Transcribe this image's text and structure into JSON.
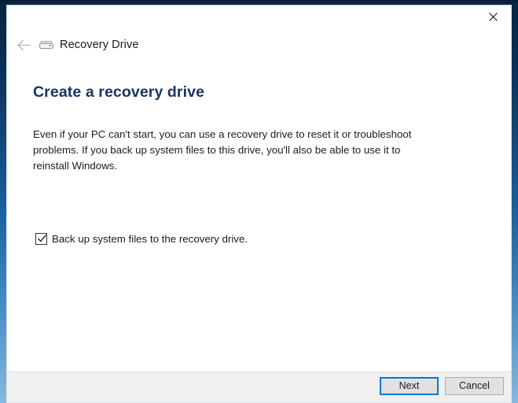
{
  "window": {
    "app_title": "Recovery Drive",
    "app_icon": "drive-icon",
    "back_icon": "back-arrow-icon",
    "close_icon": "close-icon",
    "close_label": "Close"
  },
  "page": {
    "heading": "Create a recovery drive",
    "description": "Even if your PC can't start, you can use a recovery drive to reset it or troubleshoot problems. If you back up system files to this drive, you'll also be able to use it to reinstall Windows.",
    "checkbox": {
      "label": "Back up system files to the recovery drive.",
      "checked": true,
      "icon": "check-icon"
    }
  },
  "footer": {
    "next_label": "Next",
    "cancel_label": "Cancel"
  },
  "colors": {
    "heading": "#18355f",
    "accent": "#0078d7",
    "button_face": "#e1e1e1",
    "button_border": "#adadad",
    "footer_bg": "#f0f0f0",
    "window_bg": "#ffffff",
    "desktop": "#0a2a4a",
    "text": "#1c1c1c"
  }
}
